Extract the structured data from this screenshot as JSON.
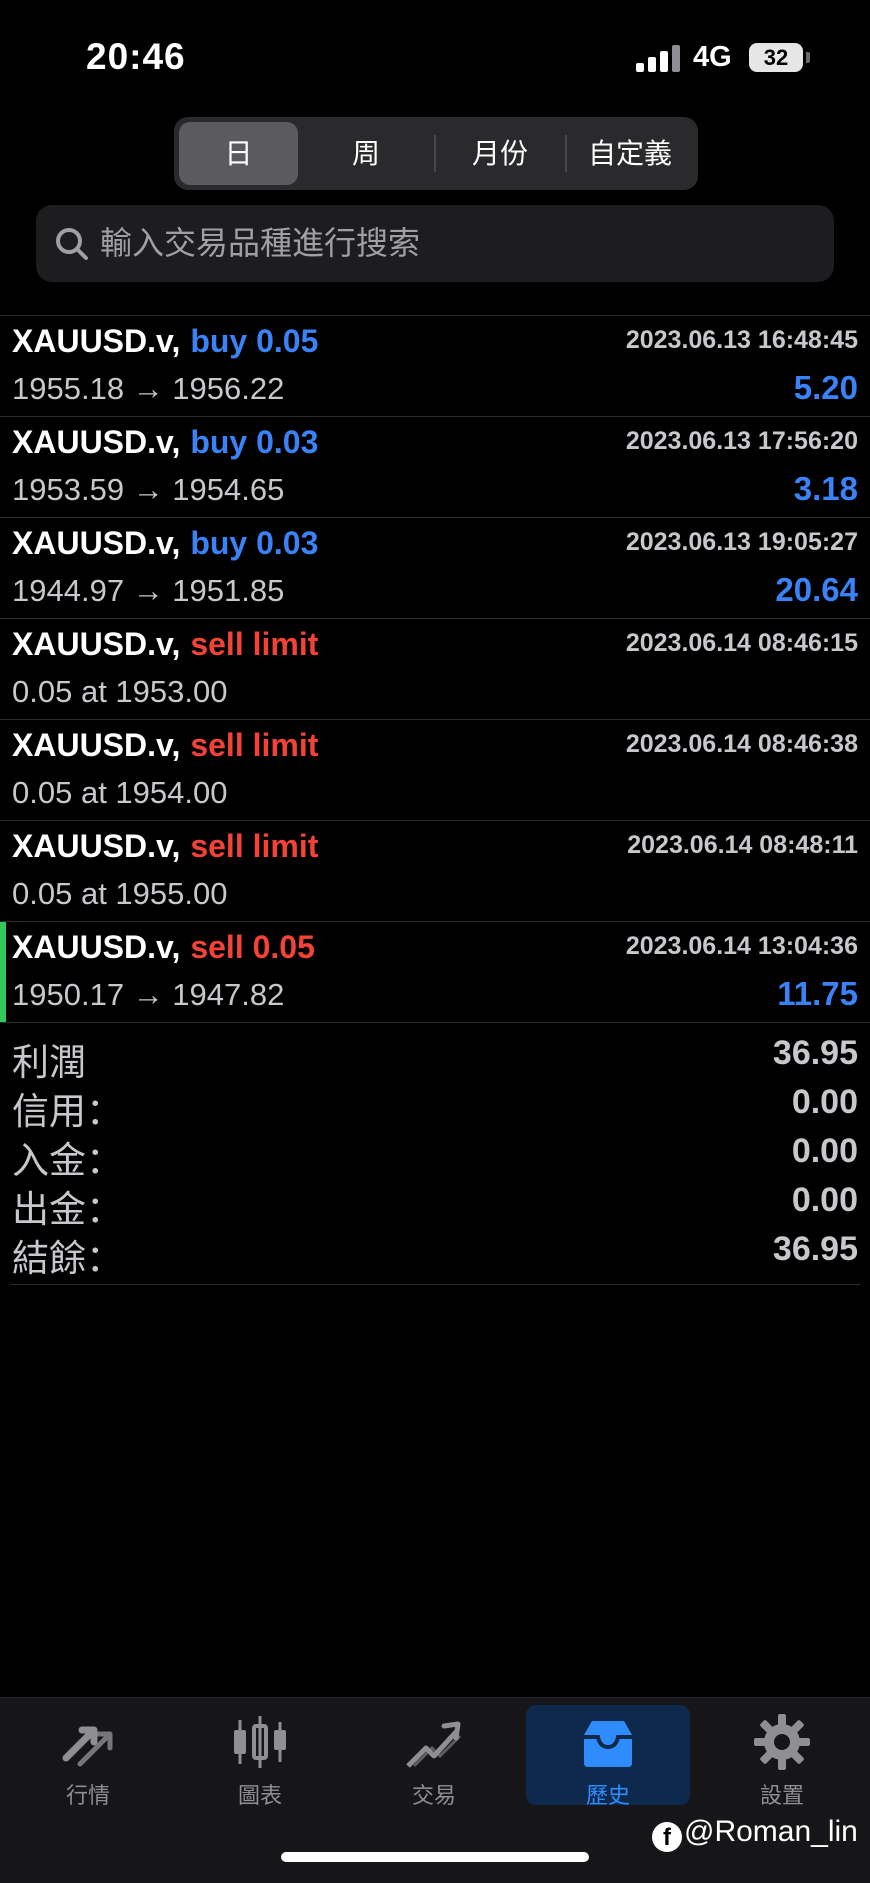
{
  "status_bar": {
    "time": "20:46",
    "network": "4G",
    "battery": "32"
  },
  "segments": [
    "日",
    "周",
    "月份",
    "自定義"
  ],
  "search": {
    "placeholder": "輸入交易品種進行搜索"
  },
  "orders": [
    {
      "symbol": "XAUUSD.v,",
      "action": "buy 0.05",
      "action_type": "buy",
      "time": "2023.06.13 16:48:45",
      "detail": "1955.18 → 1956.22",
      "profit": "5.20"
    },
    {
      "symbol": "XAUUSD.v,",
      "action": "buy 0.03",
      "action_type": "buy",
      "time": "2023.06.13 17:56:20",
      "detail": "1953.59 → 1954.65",
      "profit": "3.18"
    },
    {
      "symbol": "XAUUSD.v,",
      "action": "buy 0.03",
      "action_type": "buy",
      "time": "2023.06.13 19:05:27",
      "detail": "1944.97 → 1951.85",
      "profit": "20.64"
    },
    {
      "symbol": "XAUUSD.v,",
      "action": "sell limit",
      "action_type": "sell",
      "time": "2023.06.14 08:46:15",
      "detail": "0.05 at 1953.00",
      "profit": ""
    },
    {
      "symbol": "XAUUSD.v,",
      "action": "sell limit",
      "action_type": "sell",
      "time": "2023.06.14 08:46:38",
      "detail": "0.05 at 1954.00",
      "profit": ""
    },
    {
      "symbol": "XAUUSD.v,",
      "action": "sell limit",
      "action_type": "sell",
      "time": "2023.06.14 08:48:11",
      "detail": "0.05 at 1955.00",
      "profit": ""
    },
    {
      "symbol": "XAUUSD.v,",
      "action": "sell 0.05",
      "action_type": "sell",
      "time": "2023.06.14 13:04:36",
      "detail": "1950.17 → 1947.82",
      "profit": "11.75"
    }
  ],
  "summary": [
    {
      "label": "利潤",
      "value": "36.95"
    },
    {
      "label": "信用：",
      "value": "0.00"
    },
    {
      "label": "入金：",
      "value": "0.00"
    },
    {
      "label": "出金：",
      "value": "0.00"
    },
    {
      "label": "結餘：",
      "value": "36.95"
    }
  ],
  "tabs": [
    {
      "label": "行情",
      "icon": "quotes-icon"
    },
    {
      "label": "圖表",
      "icon": "chart-icon"
    },
    {
      "label": "交易",
      "icon": "trade-icon"
    },
    {
      "label": "歷史",
      "icon": "history-icon"
    },
    {
      "label": "設置",
      "icon": "settings-icon"
    }
  ],
  "watermark": "@Roman_lin",
  "colors": {
    "buy": "#3a82f7",
    "sell": "#f44336",
    "active_tab": "#2f8cff",
    "marker": "#34c759"
  }
}
